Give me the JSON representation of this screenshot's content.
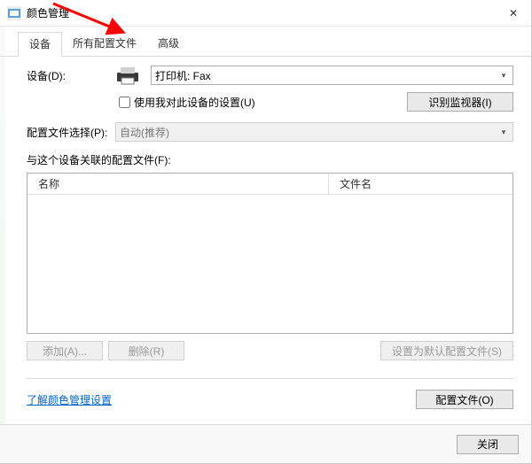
{
  "window": {
    "title": "颜色管理",
    "close_symbol": "✕"
  },
  "tabs": {
    "device": "设备",
    "all_profiles": "所有配置文件",
    "advanced": "高级"
  },
  "device_row": {
    "label": "设备(D):",
    "selected": "打印机: Fax"
  },
  "use_my_settings": {
    "label": "使用我对此设备的设置(U)",
    "checked": false
  },
  "identify_btn": "识别监视器(I)",
  "profile_select_row": {
    "label": "配置文件选择(P):",
    "value": "自动(推荐)"
  },
  "assoc_label": "与这个设备关联的配置文件(F):",
  "columns": {
    "name": "名称",
    "filename": "文件名"
  },
  "buttons": {
    "add": "添加(A)...",
    "remove": "删除(R)",
    "set_default": "设置为默认配置文件(S)",
    "profiles": "配置文件(O)",
    "close": "关闭"
  },
  "link": "了解颜色管理设置"
}
